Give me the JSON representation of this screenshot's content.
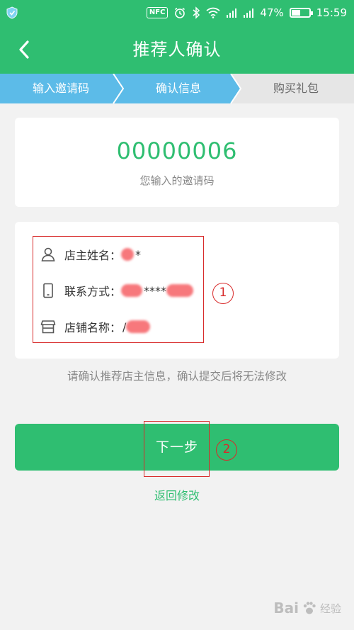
{
  "status_bar": {
    "nfc": "NFC",
    "battery": "47%",
    "time": "15:59",
    "icons": [
      "shield-icon",
      "alarm-icon",
      "bluetooth-icon",
      "wifi-icon",
      "signal-icon",
      "battery-icon"
    ]
  },
  "header": {
    "title": "推荐人确认",
    "back_icon": "chevron-left-icon"
  },
  "steps": [
    {
      "label": "输入邀请码",
      "state": "done"
    },
    {
      "label": "确认信息",
      "state": "current"
    },
    {
      "label": "购买礼包",
      "state": "pending"
    }
  ],
  "invite": {
    "code": "00000006",
    "caption": "您输入的邀请码"
  },
  "info": {
    "owner_label": "店主姓名：",
    "owner_value": "*",
    "phone_label": "联系方式：",
    "phone_value": "****",
    "shop_label": "店铺名称：",
    "shop_value": "/"
  },
  "annotations": {
    "marker_1": "1",
    "marker_2": "2"
  },
  "notice": "请确认推荐店主信息，确认提交后将无法修改",
  "buttons": {
    "next": "下一步",
    "back": "返回修改"
  },
  "watermark": {
    "brand": "Bai",
    "brand_suffix": "经验",
    "icon": "paw-icon"
  },
  "colors": {
    "brand_green": "#2fbe71",
    "step_blue": "#5cbbe8",
    "step_gray": "#e6e6e6",
    "annotation_red": "#d82a2a"
  }
}
